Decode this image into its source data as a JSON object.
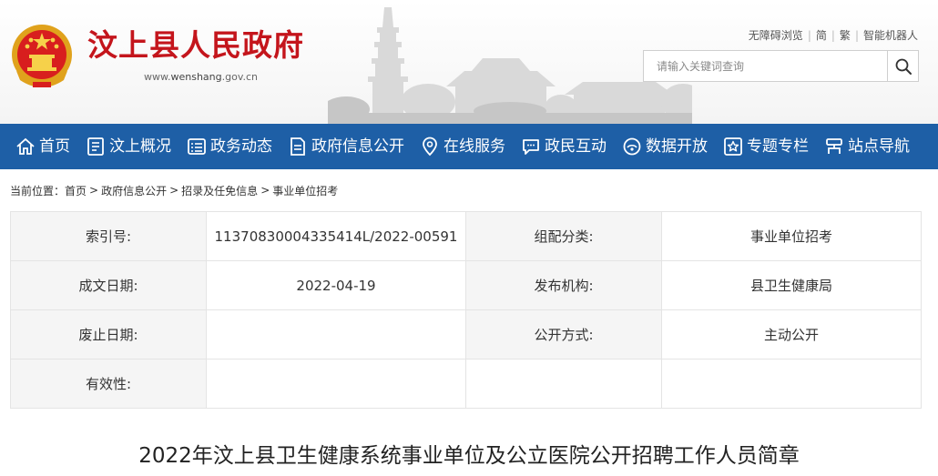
{
  "header": {
    "site_title": "汶上县人民政府",
    "url_prefix": "www.",
    "url_domain": "wenshang",
    "url_suffix": ".gov.cn",
    "emblem_icon": "national-emblem-icon",
    "brand_color": "#c4151c"
  },
  "top_links": {
    "accessibility": "无障碍浏览",
    "simplified": "简",
    "traditional": "繁",
    "robot": "智能机器人"
  },
  "search": {
    "placeholder": "请输入关键词查询",
    "icon": "search-icon"
  },
  "nav": {
    "color": "#1e5fa6",
    "items": [
      {
        "label": "首页",
        "icon": "home-icon"
      },
      {
        "label": "汶上概况",
        "icon": "overview-icon"
      },
      {
        "label": "政务动态",
        "icon": "news-icon"
      },
      {
        "label": "政府信息公开",
        "icon": "document-icon"
      },
      {
        "label": "在线服务",
        "icon": "location-icon"
      },
      {
        "label": "政民互动",
        "icon": "chat-icon"
      },
      {
        "label": "数据开放",
        "icon": "data-icon"
      },
      {
        "label": "专题专栏",
        "icon": "star-icon"
      },
      {
        "label": "站点导航",
        "icon": "sitemap-icon"
      }
    ]
  },
  "breadcrumb": {
    "prefix": "当前位置：",
    "items": [
      "首页",
      "政府信息公开",
      "招录及任免信息",
      "事业单位招考"
    ]
  },
  "info": {
    "index_label": "索引号:",
    "index_value": "11370830004335414L/2022-00591",
    "category_label": "组配分类:",
    "category_value": "事业单位招考",
    "date_label": "成文日期:",
    "date_value": "2022-04-19",
    "publisher_label": "发布机构:",
    "publisher_value": "县卫生健康局",
    "expiry_label": "废止日期:",
    "expiry_value": "",
    "method_label": "公开方式:",
    "method_value": "主动公开",
    "validity_label": "有效性:",
    "validity_value": ""
  },
  "article": {
    "title": "2022年汶上县卫生健康系统事业单位及公立医院公开招聘工作人员简章"
  }
}
